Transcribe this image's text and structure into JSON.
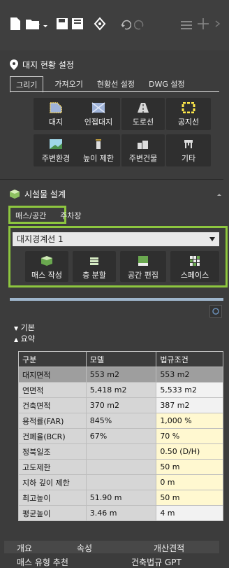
{
  "site": {
    "title": "대지 현황 설정",
    "tabs": [
      "그리기",
      "가져오기",
      "현황선 설정",
      "DWG 설정"
    ],
    "buttons": [
      "대지",
      "인접대지",
      "도로선",
      "공지선",
      "주변환경",
      "높이 제한",
      "주변건물",
      "기타"
    ]
  },
  "facility": {
    "title": "시설물 설계",
    "tabs": [
      "매스/공간",
      "주차장"
    ],
    "select_value": "대지경계선 1",
    "buttons": [
      "매스 작성",
      "층 분할",
      "공간 편집",
      "스페이스"
    ]
  },
  "summary": {
    "basic_label": "기본",
    "summary_label": "요약",
    "headers": [
      "구분",
      "모델",
      "법규조건"
    ],
    "rows": [
      [
        "대지면적",
        "553 m2",
        "553 m2"
      ],
      [
        "연면적",
        "5,418 m2",
        "5,533 m2"
      ],
      [
        "건축면적",
        "370 m2",
        "387 m2"
      ],
      [
        "용적률(FAR)",
        "845%",
        "1,000 %"
      ],
      [
        "건폐율(BCR)",
        "67%",
        "70 %"
      ],
      [
        "정북일조",
        "",
        "0.50 (D/H)"
      ],
      [
        "고도제한",
        "",
        "50 m"
      ],
      [
        "지하 깊이 제한",
        "",
        "0 m"
      ],
      [
        "최고높이",
        "51.90 m",
        "50 m"
      ],
      [
        "평균높이",
        "3.46 m",
        "4 m"
      ]
    ]
  },
  "bottom": {
    "tabs": [
      "개요",
      "속성",
      "개산견적"
    ],
    "tabs2": [
      "매스 유형 추천",
      "건축법규 GPT"
    ]
  },
  "colors": {
    "highlight": "#8dc63f",
    "background": "#3c3c3c",
    "editable_cell": "#fff8d0"
  }
}
